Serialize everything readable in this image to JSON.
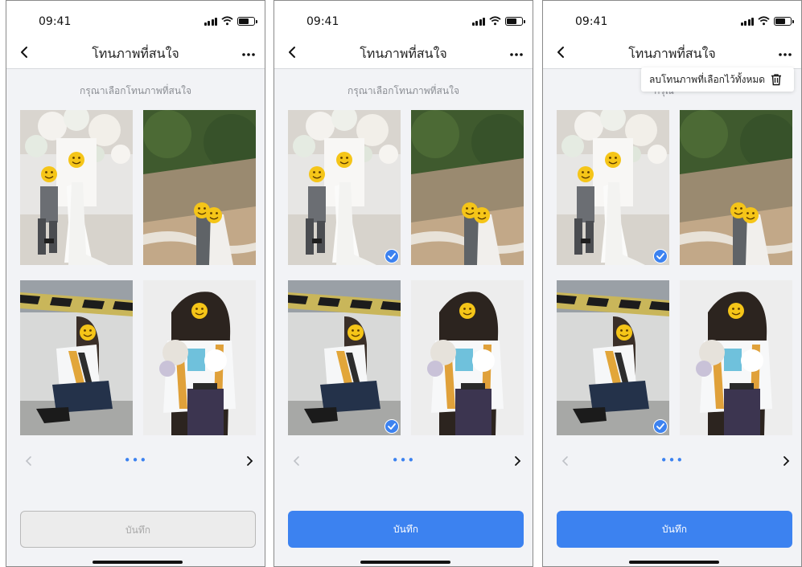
{
  "status": {
    "time": "09:41"
  },
  "nav": {
    "title": "โทนภาพที่สนใจ"
  },
  "subtitle": "กรุณาเลือกโทนภาพที่สนใจ",
  "subtitle_truncated": "กรุณ",
  "pager": {
    "indicator": "•••"
  },
  "save_label": "บันทึก",
  "menu": {
    "delete_all_label": "ลบโทนภาพที่เลือกไว้ทั้งหมด"
  },
  "colors": {
    "accent": "#3c82f0",
    "disabled_bg": "#ececec",
    "screen_bg": "#f2f3f6"
  },
  "screens": [
    {
      "state": "none selected",
      "selected_photos": [],
      "save_enabled": false,
      "menu_open": false
    },
    {
      "state": "two selected",
      "selected_photos": [
        1,
        3
      ],
      "save_enabled": true,
      "menu_open": false
    },
    {
      "state": "more menu open",
      "selected_photos": [
        1,
        3
      ],
      "save_enabled": true,
      "menu_open": true
    }
  ],
  "photos": [
    {
      "name": "wedding-floral-photo"
    },
    {
      "name": "beach-couple-photo"
    },
    {
      "name": "graduate-crouching-photo"
    },
    {
      "name": "graduate-bouquet-photo"
    }
  ]
}
